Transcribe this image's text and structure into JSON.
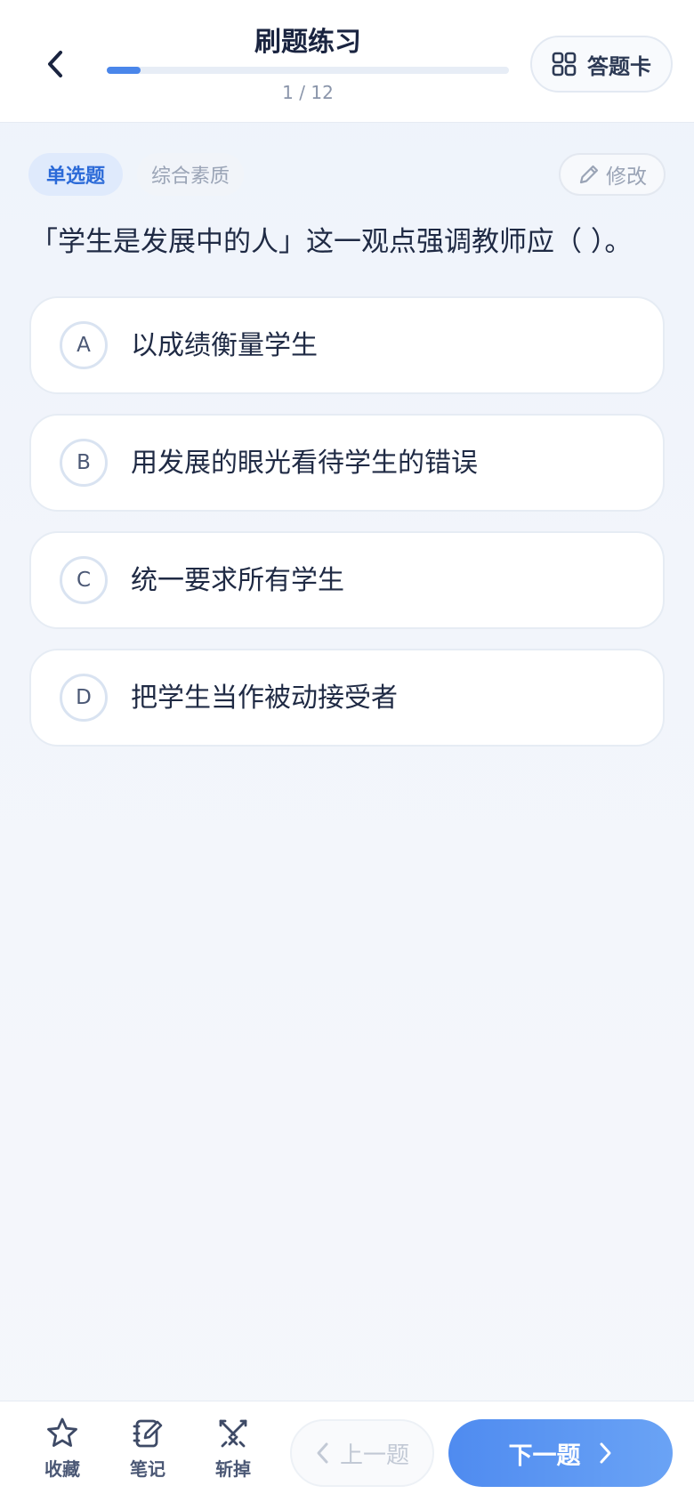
{
  "header": {
    "title": "刷题练习",
    "progress_text": "1 / 12",
    "progress_current": 1,
    "progress_total": 12,
    "answer_card_label": "答题卡"
  },
  "question": {
    "type_tag": "单选题",
    "subject_tag": "综合素质",
    "edit_label": "修改",
    "text": "「学生是发展中的人」这一观点强调教师应（ ）。",
    "options": [
      {
        "letter": "A",
        "text": "以成绩衡量学生"
      },
      {
        "letter": "B",
        "text": "用发展的眼光看待学生的错误"
      },
      {
        "letter": "C",
        "text": "统一要求所有学生"
      },
      {
        "letter": "D",
        "text": "把学生当作被动接受者"
      }
    ]
  },
  "bottom_bar": {
    "favorite_label": "收藏",
    "note_label": "笔记",
    "remove_label": "斩掉",
    "prev_label": "上一题",
    "next_label": "下一题"
  },
  "colors": {
    "accent": "#4a86ea",
    "tag_bg": "#dfeafc",
    "tag_text": "#2b6ad8",
    "text_primary": "#1f2a44",
    "text_muted": "#9aa4b6"
  },
  "icons": [
    "back-chevron-icon",
    "grid-icon",
    "pencil-icon",
    "star-icon",
    "notebook-icon",
    "crossed-swords-icon",
    "chevron-left-icon",
    "chevron-right-icon"
  ]
}
